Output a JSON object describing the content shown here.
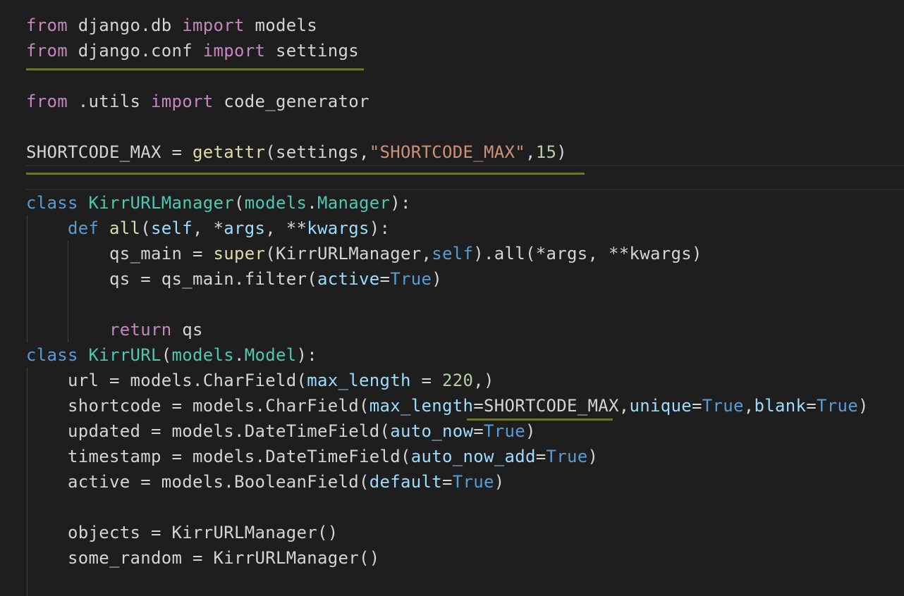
{
  "code_lines": [
    {
      "name": "code-line-1",
      "tokens": [
        {
          "t": "kw",
          "v": "from"
        },
        {
          "t": "txt",
          "v": " django.db "
        },
        {
          "t": "kw",
          "v": "import"
        },
        {
          "t": "txt",
          "v": " models"
        }
      ]
    },
    {
      "name": "code-line-2",
      "tokens": [
        {
          "t": "kw",
          "v": "from"
        },
        {
          "t": "txt",
          "v": " django.conf "
        },
        {
          "t": "kw",
          "v": "import"
        },
        {
          "t": "txt",
          "v": " settings"
        }
      ]
    },
    {
      "name": "code-line-3",
      "tokens": []
    },
    {
      "name": "code-line-4",
      "tokens": [
        {
          "t": "kw",
          "v": "from"
        },
        {
          "t": "txt",
          "v": " .utils "
        },
        {
          "t": "kw",
          "v": "import"
        },
        {
          "t": "txt",
          "v": " code_generator"
        }
      ]
    },
    {
      "name": "code-line-5",
      "tokens": []
    },
    {
      "name": "code-line-6",
      "tokens": [
        {
          "t": "txt",
          "v": "SHORTCODE_MAX = "
        },
        {
          "t": "fn",
          "v": "getattr"
        },
        {
          "t": "txt",
          "v": "(settings,"
        },
        {
          "t": "str",
          "v": "\"SHORTCODE_MAX\""
        },
        {
          "t": "txt",
          "v": ","
        },
        {
          "t": "num",
          "v": "15"
        },
        {
          "t": "txt",
          "v": ")"
        }
      ]
    },
    {
      "name": "code-line-7",
      "tokens": []
    },
    {
      "name": "code-line-8",
      "tokens": [
        {
          "t": "kb",
          "v": "class"
        },
        {
          "t": "txt",
          "v": " "
        },
        {
          "t": "cls",
          "v": "KirrURLManager"
        },
        {
          "t": "txt",
          "v": "("
        },
        {
          "t": "cls",
          "v": "models"
        },
        {
          "t": "txt",
          "v": "."
        },
        {
          "t": "cls",
          "v": "Manager"
        },
        {
          "t": "txt",
          "v": "):"
        }
      ]
    },
    {
      "name": "code-line-9",
      "tokens": [
        {
          "t": "txt",
          "v": "    "
        },
        {
          "t": "kb",
          "v": "def"
        },
        {
          "t": "txt",
          "v": " "
        },
        {
          "t": "fn",
          "v": "all"
        },
        {
          "t": "txt",
          "v": "("
        },
        {
          "t": "prm",
          "v": "self"
        },
        {
          "t": "txt",
          "v": ", *"
        },
        {
          "t": "prm",
          "v": "args"
        },
        {
          "t": "txt",
          "v": ", **"
        },
        {
          "t": "prm",
          "v": "kwargs"
        },
        {
          "t": "txt",
          "v": "):"
        }
      ]
    },
    {
      "name": "code-line-10",
      "tokens": [
        {
          "t": "txt",
          "v": "        qs_main = "
        },
        {
          "t": "fn",
          "v": "super"
        },
        {
          "t": "txt",
          "v": "(KirrURLManager,"
        },
        {
          "t": "kb",
          "v": "self"
        },
        {
          "t": "txt",
          "v": ").all(*args, **kwargs)"
        }
      ]
    },
    {
      "name": "code-line-11",
      "tokens": [
        {
          "t": "txt",
          "v": "        qs = qs_main.filter("
        },
        {
          "t": "prm",
          "v": "active"
        },
        {
          "t": "txt",
          "v": "="
        },
        {
          "t": "kb",
          "v": "True"
        },
        {
          "t": "txt",
          "v": ")"
        }
      ]
    },
    {
      "name": "code-line-12",
      "tokens": []
    },
    {
      "name": "code-line-13",
      "tokens": [
        {
          "t": "txt",
          "v": "        "
        },
        {
          "t": "kw",
          "v": "return"
        },
        {
          "t": "txt",
          "v": " qs"
        }
      ]
    },
    {
      "name": "code-line-14",
      "tokens": [
        {
          "t": "kb",
          "v": "class"
        },
        {
          "t": "txt",
          "v": " "
        },
        {
          "t": "cls",
          "v": "KirrURL"
        },
        {
          "t": "txt",
          "v": "("
        },
        {
          "t": "cls",
          "v": "models"
        },
        {
          "t": "txt",
          "v": "."
        },
        {
          "t": "cls",
          "v": "Model"
        },
        {
          "t": "txt",
          "v": "):"
        }
      ]
    },
    {
      "name": "code-line-15",
      "tokens": [
        {
          "t": "txt",
          "v": "    url = models.CharField("
        },
        {
          "t": "prm",
          "v": "max_length"
        },
        {
          "t": "txt",
          "v": " = "
        },
        {
          "t": "num",
          "v": "220"
        },
        {
          "t": "txt",
          "v": ",)"
        }
      ]
    },
    {
      "name": "code-line-16",
      "tokens": [
        {
          "t": "txt",
          "v": "    shortcode = models.CharField("
        },
        {
          "t": "prm",
          "v": "max_length"
        },
        {
          "t": "txt",
          "v": "=SHORTCODE_MAX,"
        },
        {
          "t": "prm",
          "v": "unique"
        },
        {
          "t": "txt",
          "v": "="
        },
        {
          "t": "kb",
          "v": "True"
        },
        {
          "t": "txt",
          "v": ","
        },
        {
          "t": "prm",
          "v": "blank"
        },
        {
          "t": "txt",
          "v": "="
        },
        {
          "t": "kb",
          "v": "True"
        },
        {
          "t": "txt",
          "v": ")"
        }
      ]
    },
    {
      "name": "code-line-17",
      "tokens": [
        {
          "t": "txt",
          "v": "    updated = models.DateTimeField("
        },
        {
          "t": "prm",
          "v": "auto_now"
        },
        {
          "t": "txt",
          "v": "="
        },
        {
          "t": "kb",
          "v": "True"
        },
        {
          "t": "txt",
          "v": ")"
        }
      ]
    },
    {
      "name": "code-line-18",
      "tokens": [
        {
          "t": "txt",
          "v": "    timestamp = models.DateTimeField("
        },
        {
          "t": "prm",
          "v": "auto_now_add"
        },
        {
          "t": "txt",
          "v": "="
        },
        {
          "t": "kb",
          "v": "True"
        },
        {
          "t": "txt",
          "v": ")"
        }
      ]
    },
    {
      "name": "code-line-19",
      "tokens": [
        {
          "t": "txt",
          "v": "    active = models.BooleanField("
        },
        {
          "t": "prm",
          "v": "default"
        },
        {
          "t": "txt",
          "v": "="
        },
        {
          "t": "kb",
          "v": "True"
        },
        {
          "t": "txt",
          "v": ")"
        }
      ]
    },
    {
      "name": "code-line-20",
      "tokens": []
    },
    {
      "name": "code-line-21",
      "tokens": [
        {
          "t": "txt",
          "v": "    objects = KirrURLManager()"
        }
      ]
    },
    {
      "name": "code-line-22",
      "tokens": [
        {
          "t": "txt",
          "v": "    some_random = KirrURLManager()"
        }
      ]
    }
  ]
}
